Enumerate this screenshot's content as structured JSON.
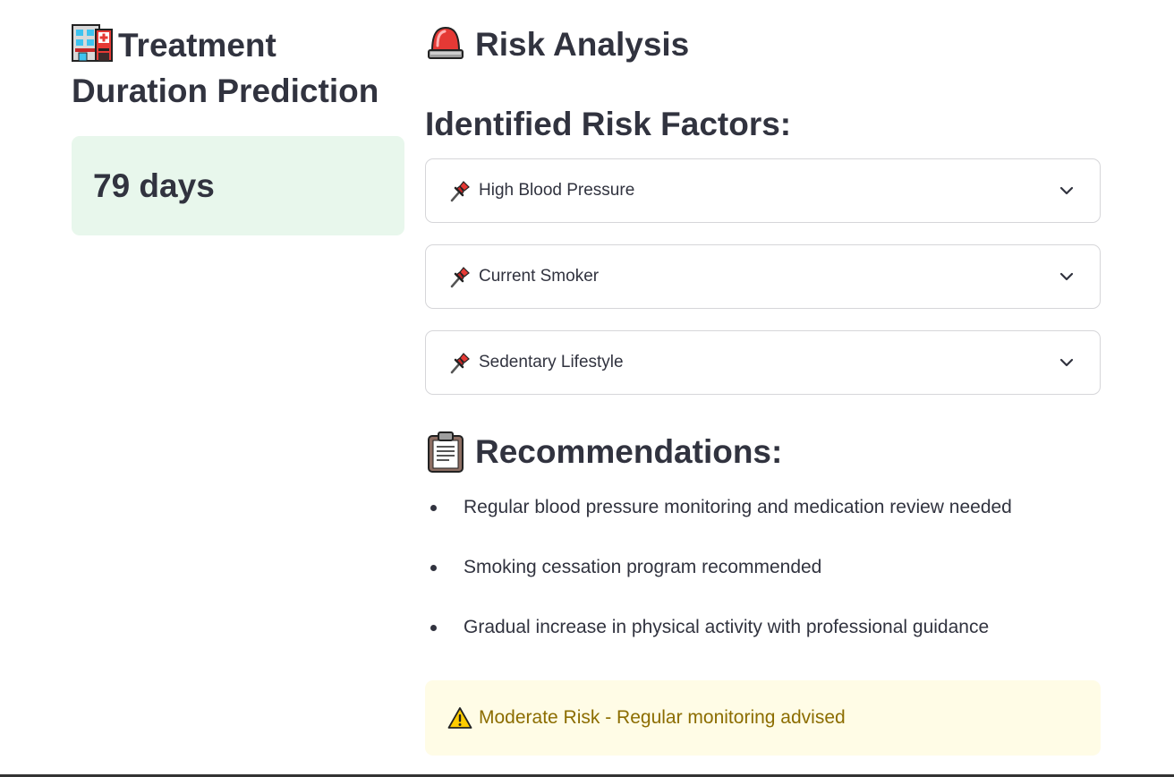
{
  "treatment": {
    "title": "Treatment Duration Prediction",
    "icon": "hospital-icon",
    "prediction_value": "79 days"
  },
  "risk": {
    "heading": "Risk Analysis",
    "icon": "siren-icon",
    "factors_heading": "Identified Risk Factors:",
    "factors": [
      {
        "label": "High Blood Pressure",
        "icon": "pushpin-icon"
      },
      {
        "label": "Current Smoker",
        "icon": "pushpin-icon"
      },
      {
        "label": "Sedentary Lifestyle",
        "icon": "pushpin-icon"
      }
    ]
  },
  "recommendations": {
    "heading": "Recommendations:",
    "icon": "clipboard-icon",
    "items": [
      "Regular blood pressure monitoring and medication review needed",
      "Smoking cessation program recommended",
      "Gradual increase in physical activity with professional guidance"
    ]
  },
  "alert": {
    "icon": "warning-icon",
    "text": "Moderate Risk - Regular monitoring advised"
  },
  "colors": {
    "success_bg": "#e8f7ec",
    "warning_bg": "#fffce6",
    "warning_text": "#8c6d00",
    "text": "#31333f",
    "border": "#d6d6d9"
  }
}
